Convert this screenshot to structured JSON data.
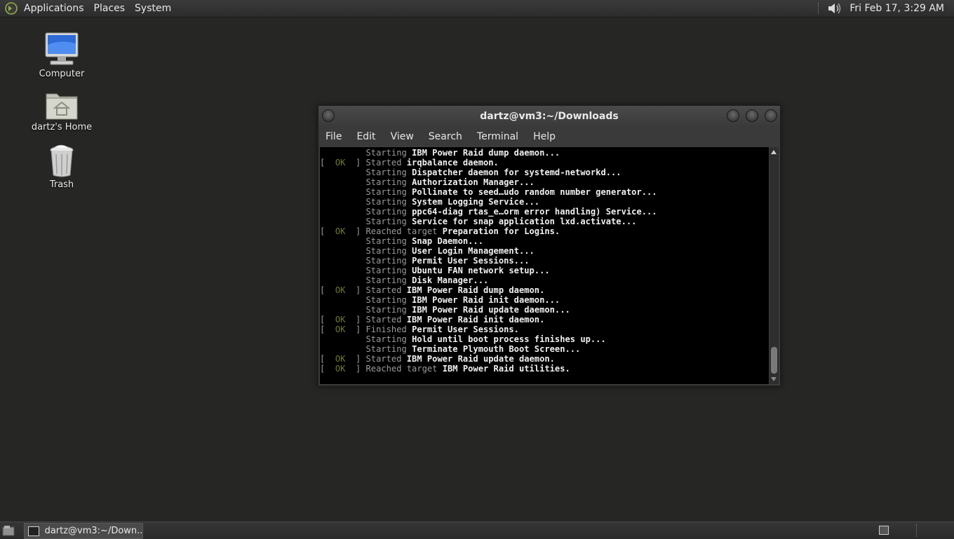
{
  "top_panel": {
    "menus": [
      "Applications",
      "Places",
      "System"
    ],
    "clock": "Fri Feb 17,  3:29 AM",
    "icons": {
      "logo": "mate-menu-icon",
      "volume": "volume-icon"
    }
  },
  "desktop": {
    "icons": [
      {
        "label": "Computer",
        "icon": "computer-icon"
      },
      {
        "label": "dartz's Home",
        "icon": "home-folder-icon"
      },
      {
        "label": "Trash",
        "icon": "trash-icon"
      }
    ]
  },
  "terminal": {
    "title": "dartz@vm3:~/Downloads",
    "menus": [
      "File",
      "Edit",
      "View",
      "Search",
      "Terminal",
      "Help"
    ],
    "ok_text": "OK",
    "lines": [
      {
        "prefix": "         Starting ",
        "ok": false,
        "bold": "IBM Power Raid dump daemon..."
      },
      {
        "prefix": "] Started ",
        "ok": true,
        "bold": "irqbalance daemon."
      },
      {
        "prefix": "         Starting ",
        "ok": false,
        "bold": "Dispatcher daemon for systemd-networkd..."
      },
      {
        "prefix": "         Starting ",
        "ok": false,
        "bold": "Authorization Manager..."
      },
      {
        "prefix": "         Starting ",
        "ok": false,
        "bold": "Pollinate to seed…udo random number generator..."
      },
      {
        "prefix": "         Starting ",
        "ok": false,
        "bold": "System Logging Service..."
      },
      {
        "prefix": "         Starting ",
        "ok": false,
        "bold": "ppc64-diag rtas_e…orm error handling) Service..."
      },
      {
        "prefix": "         Starting ",
        "ok": false,
        "bold": "Service for snap application lxd.activate..."
      },
      {
        "prefix": "] Reached target ",
        "ok": true,
        "bold": "Preparation for Logins."
      },
      {
        "prefix": "         Starting ",
        "ok": false,
        "bold": "Snap Daemon..."
      },
      {
        "prefix": "         Starting ",
        "ok": false,
        "bold": "User Login Management..."
      },
      {
        "prefix": "         Starting ",
        "ok": false,
        "bold": "Permit User Sessions..."
      },
      {
        "prefix": "         Starting ",
        "ok": false,
        "bold": "Ubuntu FAN network setup..."
      },
      {
        "prefix": "         Starting ",
        "ok": false,
        "bold": "Disk Manager..."
      },
      {
        "prefix": "] Started ",
        "ok": true,
        "bold": "IBM Power Raid dump daemon."
      },
      {
        "prefix": "         Starting ",
        "ok": false,
        "bold": "IBM Power Raid init daemon..."
      },
      {
        "prefix": "         Starting ",
        "ok": false,
        "bold": "IBM Power Raid update daemon..."
      },
      {
        "prefix": "] Started ",
        "ok": true,
        "bold": "IBM Power Raid init daemon."
      },
      {
        "prefix": "] Finished ",
        "ok": true,
        "bold": "Permit User Sessions."
      },
      {
        "prefix": "         Starting ",
        "ok": false,
        "bold": "Hold until boot process finishes up..."
      },
      {
        "prefix": "         Starting ",
        "ok": false,
        "bold": "Terminate Plymouth Boot Screen..."
      },
      {
        "prefix": "] Started ",
        "ok": true,
        "bold": "IBM Power Raid update daemon."
      },
      {
        "prefix": "] Reached target ",
        "ok": true,
        "bold": "IBM Power Raid utilities."
      }
    ]
  },
  "taskbar": {
    "window_label": "dartz@vm3:~/Down...",
    "icons": {
      "show_desktop": "show-desktop-icon",
      "task": "terminal-icon",
      "workspace": "workspace-switcher-icon"
    }
  }
}
